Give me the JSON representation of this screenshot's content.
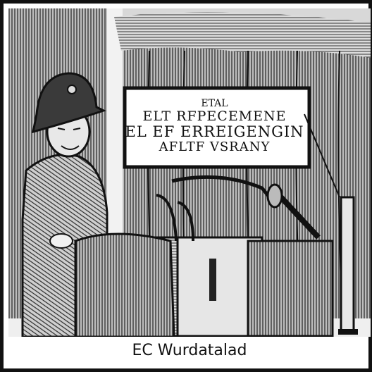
{
  "sign": {
    "line1": "ETAL",
    "line2": "ELT  RFPECEMENE",
    "line3": "EL EF ERREIGENGIN",
    "line4": "AFLTF  VSRANY"
  },
  "caption": "EC Wurdatalad"
}
